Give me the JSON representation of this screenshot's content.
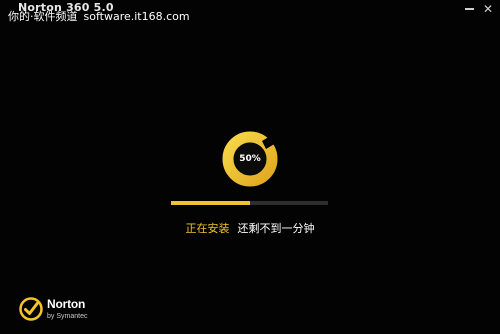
{
  "window": {
    "title": "Norton 360 5.0",
    "minimize_icon": "minimize-icon",
    "close_icon": "close-icon",
    "close_glyph": "✕"
  },
  "watermark": {
    "text": "你的·软件频道",
    "site": "software.it168.com"
  },
  "installer": {
    "progress_percent": 50,
    "progress_label": "50%",
    "status": "正在安装",
    "remaining": "还剩不到一分钟",
    "icon": "progress-ring-icon"
  },
  "branding": {
    "name": "Norton",
    "sub": "by Symantec",
    "icon": "norton-check-logo-icon"
  },
  "colors": {
    "accent": "#f5c42a",
    "ring_light": "#f7cf3a",
    "ring_dark": "#d79a1a",
    "background": "#030303",
    "track": "#2e2e2e"
  }
}
